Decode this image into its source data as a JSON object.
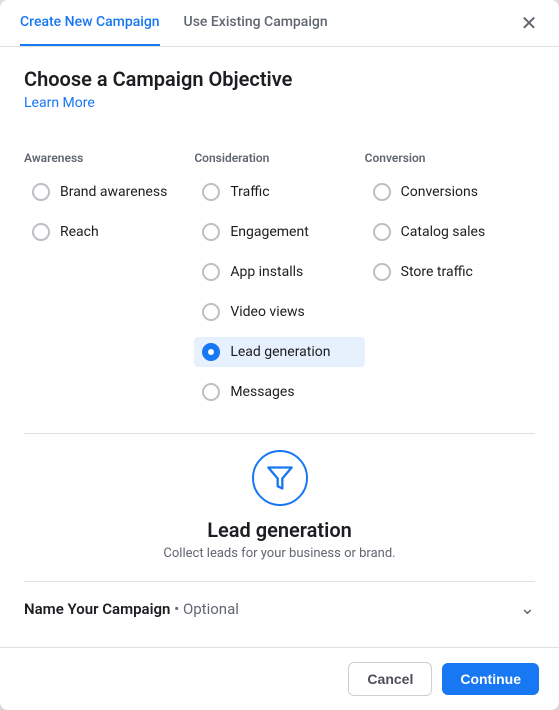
{
  "tabs": [
    {
      "id": "create",
      "label": "Create New Campaign",
      "active": true
    },
    {
      "id": "existing",
      "label": "Use Existing Campaign",
      "active": false
    }
  ],
  "close_icon": "✕",
  "title": "Choose a Campaign Objective",
  "learn_more": "Learn More",
  "columns": [
    {
      "header": "Awareness",
      "options": [
        {
          "id": "brand-awareness",
          "label": "Brand awareness",
          "selected": false
        },
        {
          "id": "reach",
          "label": "Reach",
          "selected": false
        }
      ]
    },
    {
      "header": "Consideration",
      "options": [
        {
          "id": "traffic",
          "label": "Traffic",
          "selected": false
        },
        {
          "id": "engagement",
          "label": "Engagement",
          "selected": false
        },
        {
          "id": "app-installs",
          "label": "App installs",
          "selected": false
        },
        {
          "id": "video-views",
          "label": "Video views",
          "selected": false
        },
        {
          "id": "lead-generation",
          "label": "Lead generation",
          "selected": true
        },
        {
          "id": "messages",
          "label": "Messages",
          "selected": false
        }
      ]
    },
    {
      "header": "Conversion",
      "options": [
        {
          "id": "conversions",
          "label": "Conversions",
          "selected": false
        },
        {
          "id": "catalog-sales",
          "label": "Catalog sales",
          "selected": false
        },
        {
          "id": "store-traffic",
          "label": "Store traffic",
          "selected": false
        }
      ]
    }
  ],
  "preview": {
    "title": "Lead generation",
    "description": "Collect leads for your business or brand."
  },
  "name_campaign": {
    "label": "Name Your Campaign",
    "suffix": " • Optional"
  },
  "footer": {
    "cancel": "Cancel",
    "continue": "Continue"
  }
}
